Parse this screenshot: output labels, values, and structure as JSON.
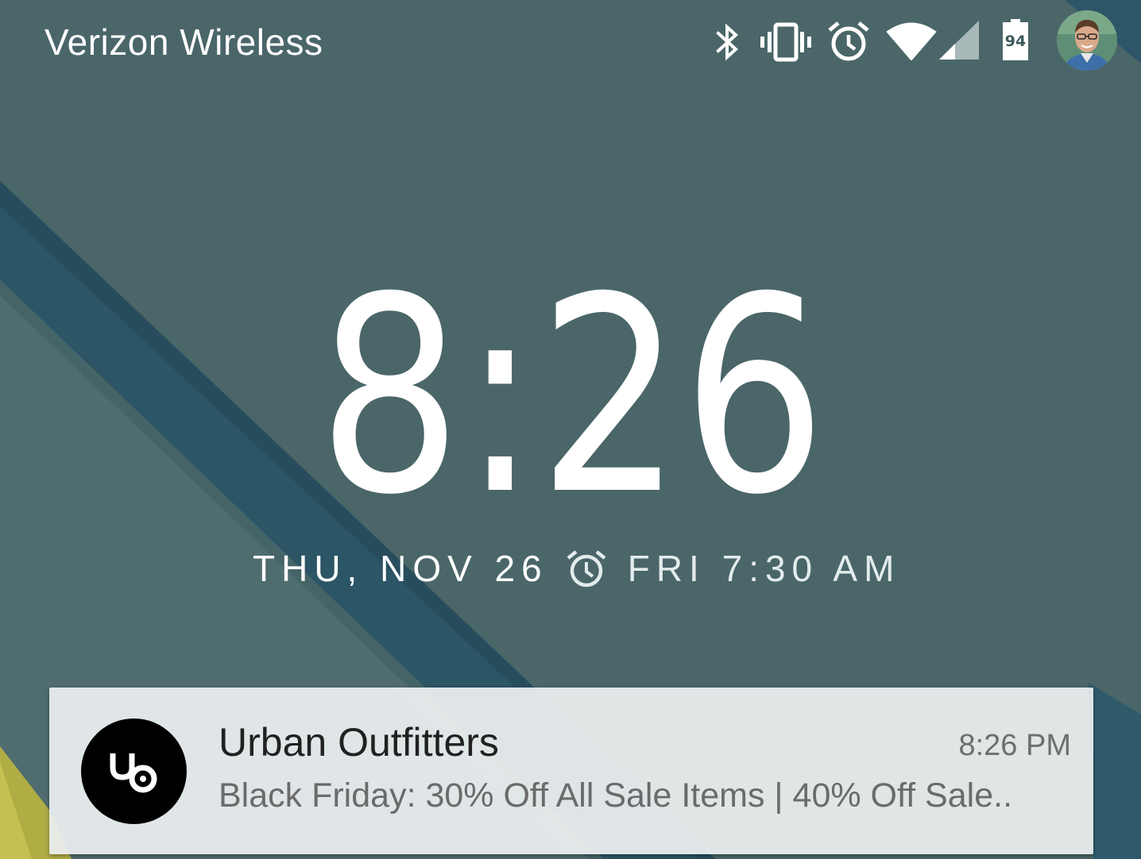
{
  "status_bar": {
    "carrier": "Verizon Wireless",
    "battery_percent": "94",
    "icons": [
      "bluetooth-icon",
      "vibrate-icon",
      "alarm-icon",
      "wifi-icon",
      "cell-signal-icon",
      "battery-icon",
      "user-avatar"
    ]
  },
  "lockscreen": {
    "time": "8:26",
    "date": "THU, NOV 26",
    "next_alarm": "FRI 7:30 AM"
  },
  "notification": {
    "app_icon": "urban-outfitters-logo",
    "title": "Urban Outfitters",
    "time": "8:26 PM",
    "body": "Black Friday: 30% Off All Sale Items | 40% Off Sale.."
  },
  "colors": {
    "background": "#4a6668",
    "stripe_dark": "#2d5668",
    "accent_yellow": "#b8b54a",
    "notification_bg": "#eceff0"
  }
}
